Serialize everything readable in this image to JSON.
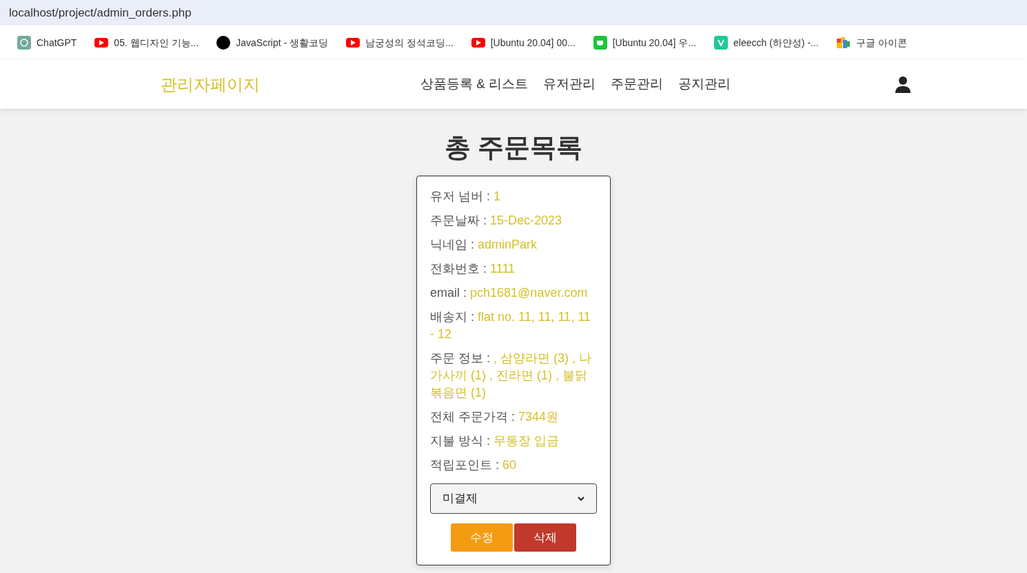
{
  "address_bar": {
    "url": "localhost/project/admin_orders.php"
  },
  "bookmarks": [
    {
      "kind": "chatgpt",
      "label": "ChatGPT"
    },
    {
      "kind": "youtube",
      "label": "05. 웹디자인 기능..."
    },
    {
      "kind": "dot",
      "label": "JavaScript - 생활코딩"
    },
    {
      "kind": "youtube",
      "label": "남궁성의 정석코딩..."
    },
    {
      "kind": "youtube",
      "label": "[Ubuntu 20.04] 00..."
    },
    {
      "kind": "cup",
      "label": "[Ubuntu 20.04] 우..."
    },
    {
      "kind": "velog",
      "label": "eleecch (하얀성) -..."
    },
    {
      "kind": "blocks",
      "label": "구글 아이콘"
    }
  ],
  "navbar": {
    "brand": "관리자페이지",
    "links": [
      "상품등록 & 리스트",
      "유저관리",
      "주문관리",
      "공지관리"
    ]
  },
  "page_title": "총 주문목록",
  "order_card": {
    "fields": [
      {
        "label": "유저 넘버 :",
        "value": "1"
      },
      {
        "label": "주문날짜 :",
        "value": "15-Dec-2023"
      },
      {
        "label": "닉네임 :",
        "value": "adminPark"
      },
      {
        "label": "전화번호 :",
        "value": "1111"
      },
      {
        "label": "email :",
        "value": "pch1681@naver.com"
      },
      {
        "label": "배송지 :",
        "value": "flat no. 11, 11, 11, 11 - 12"
      },
      {
        "label": "주문 정보 :",
        "value": ", 삼양라면 (3) , 나가사끼 (1) , 진라면 (1) , 불닭볶음면 (1)"
      },
      {
        "label": "전체 주문가격 :",
        "value": "7344원"
      },
      {
        "label": "지불 방식 :",
        "value": "무통장 입금"
      },
      {
        "label": "적립포인트 :",
        "value": "60"
      }
    ],
    "status_select": {
      "value": "미결제"
    },
    "buttons": [
      {
        "kind": "edit",
        "label": "수정"
      },
      {
        "kind": "delete",
        "label": "삭제"
      }
    ]
  }
}
